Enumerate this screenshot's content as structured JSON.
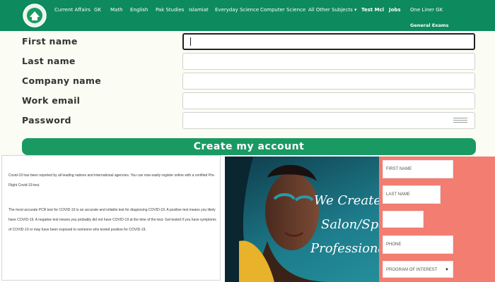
{
  "navbar": {
    "items": [
      {
        "label": "Current Affairs"
      },
      {
        "label": "GK"
      },
      {
        "label": "Math"
      },
      {
        "label": "English"
      },
      {
        "label": "Pak Studies"
      },
      {
        "label": "Islamiat"
      },
      {
        "label": "Everyday Science"
      },
      {
        "label": "Computer Science"
      },
      {
        "label": "All Other Subjects ▾"
      },
      {
        "label": "Test Mcl"
      },
      {
        "label": "Jobs"
      },
      {
        "label": "One Liner GK"
      }
    ],
    "second_row_item": "General Exams"
  },
  "signup_form": {
    "fields": [
      {
        "label": "First name",
        "value": ""
      },
      {
        "label": "Last name",
        "value": ""
      },
      {
        "label": "Company name",
        "value": ""
      },
      {
        "label": "Work email",
        "value": ""
      },
      {
        "label": "Password",
        "value": ""
      }
    ],
    "submit_label": "Create my account"
  },
  "article": {
    "paragraph1": "Covid-19 has been reported by all leading nations and international agencies. You can now easily register online with a certified Pre-Flight Covid-19 test.",
    "paragraph2": "The most accurate PCR test for COVID-19 is an accurate and reliable test for diagnosing COVID-19. A positive test means you likely have COVID-19. A negative test means you probably did not have COVID-19 at the time of the test. Get tested if you have symptoms of COVID-19 or may have been exposed to someone who tested positive for COVID-19."
  },
  "ad": {
    "headline_lines": [
      "We Create",
      "Salon/Spa",
      "Professionals"
    ],
    "form_fields": [
      {
        "placeholder": "FIRST NAME"
      },
      {
        "placeholder": "LAST NAME"
      },
      {
        "placeholder": ""
      },
      {
        "placeholder": "PHONE"
      },
      {
        "placeholder": "PROGRAM OF INTEREST",
        "type": "select"
      }
    ],
    "colors": {
      "form_bg": "#f27d70",
      "backdrop": "#1b6f80"
    }
  },
  "colors": {
    "navbar_bg": "#0d8a5e",
    "button_bg": "#1a9a63",
    "form_bg": "#fbfcf4"
  }
}
